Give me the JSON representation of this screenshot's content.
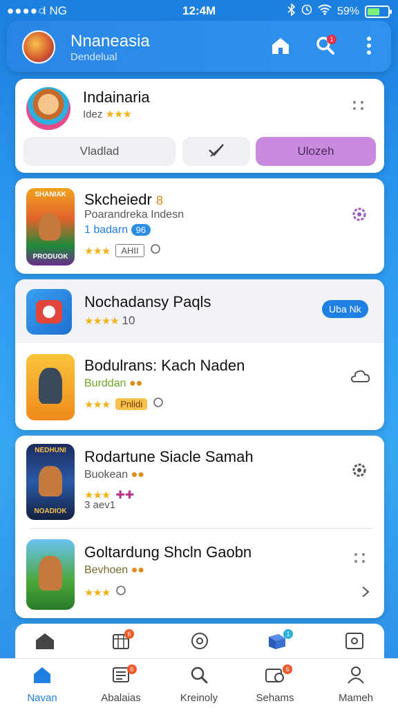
{
  "status": {
    "signal": "●●●●○",
    "carrier": "I NG",
    "time": "12:4M",
    "battery": "59%",
    "battery_level": 0.59
  },
  "header": {
    "title": "Nnaneasia",
    "subtitle": "Dendelual",
    "search_badge": "1"
  },
  "featured": {
    "title": "Indainaria",
    "rating_label": "Idez",
    "stars": "★★★",
    "segments": [
      "Vladlad",
      "",
      "Ulozeh"
    ]
  },
  "list": [
    {
      "title": "Skcheiedr",
      "tag": "8",
      "subtitle": "Poarandreka Indesn",
      "meta": "1 badarn",
      "meta_badge": "96",
      "stars": "★★★",
      "chip": "AHII"
    },
    {
      "title": "Nochadansy Paqls",
      "stars": "★★★★",
      "rating": "10",
      "action": "Uba Nk"
    },
    {
      "title": "Bodulrans: Kach Naden",
      "subtitle": "Burddan",
      "stars": "★★★",
      "chip": "Pnlidi"
    },
    {
      "title": "Rodartune Siacle Samah",
      "subtitle": "Buokean",
      "stars": "★★★",
      "meta": "3 aev1"
    },
    {
      "title": "Goltardung Shcln Gaobn",
      "subtitle": "Bevhoen",
      "stars": "★★★"
    }
  ],
  "app_art": [
    {
      "top": "SHANIAK",
      "bottom": "PRODUOK"
    },
    {
      "top": "NEDHUNI",
      "bottom": "NOADIOK"
    }
  ],
  "quickbar": {
    "badge_1": "6",
    "badge_2": "1"
  },
  "tabs": [
    {
      "label": "Navan"
    },
    {
      "label": "Abalaias",
      "badge": "6"
    },
    {
      "label": "Kreinoly"
    },
    {
      "label": "Sehams",
      "badge": "6"
    },
    {
      "label": "Mameh"
    }
  ],
  "colors": {
    "primary": "#2a86e6",
    "accent_purple": "#c98bde",
    "star": "#f1b21a",
    "active_tab": "#1f7fe3"
  }
}
